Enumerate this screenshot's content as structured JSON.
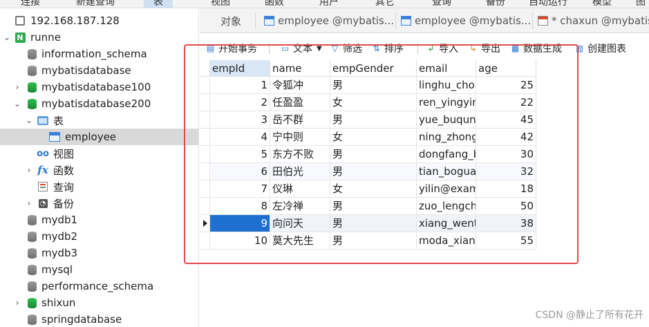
{
  "topbar": {
    "items": [
      "连接",
      "新建查询",
      "表",
      "视图",
      "函数",
      "用户",
      "其它",
      "查询",
      "备份",
      "自动运行",
      "模型",
      "图"
    ]
  },
  "sidebar": {
    "items": [
      {
        "label": "192.168.187.128",
        "icon": "server-icon"
      },
      {
        "label": "runne",
        "icon": "connection-icon"
      },
      {
        "label": "information_schema",
        "icon": "database-icon"
      },
      {
        "label": "mybatisdatabase",
        "icon": "database-icon"
      },
      {
        "label": "mybatisdatabase100",
        "icon": "database-open-icon"
      },
      {
        "label": "mybatisdatabase200",
        "icon": "database-open-icon"
      },
      {
        "label": "表",
        "icon": "tables-folder-icon"
      },
      {
        "label": "employee",
        "icon": "table-icon"
      },
      {
        "label": "视图",
        "icon": "views-icon"
      },
      {
        "label": "函数",
        "icon": "function-icon"
      },
      {
        "label": "查询",
        "icon": "query-icon"
      },
      {
        "label": "备份",
        "icon": "backup-icon"
      },
      {
        "label": "mydb1",
        "icon": "database-icon"
      },
      {
        "label": "mydb2",
        "icon": "database-icon"
      },
      {
        "label": "mydb3",
        "icon": "database-icon"
      },
      {
        "label": "mysql",
        "icon": "database-icon"
      },
      {
        "label": "performance_schema",
        "icon": "database-icon"
      },
      {
        "label": "shixun",
        "icon": "database-open-icon"
      },
      {
        "label": "springdatabase",
        "icon": "database-icon"
      }
    ]
  },
  "tabs": {
    "objects": "对象",
    "tab1": "employee @mybatis...",
    "tab2": "employee @mybatis...",
    "tab3": "* chaxun @mybatis"
  },
  "toolbar": {
    "begin_transaction": "开始事务",
    "text": "文本",
    "filter": "筛选",
    "sort": "排序",
    "import": "导入",
    "export": "导出",
    "data_generation": "数据生成",
    "create_chart": "创建图表"
  },
  "grid": {
    "columns": [
      "empId",
      "name",
      "empGender",
      "email",
      "age"
    ],
    "rows": [
      {
        "empId": "1",
        "name": "令狐冲",
        "empGender": "男",
        "email": "linghu_chon",
        "age": "25"
      },
      {
        "empId": "2",
        "name": "任盈盈",
        "empGender": "女",
        "email": "ren_yingyin",
        "age": "22"
      },
      {
        "empId": "3",
        "name": "岳不群",
        "empGender": "男",
        "email": "yue_buqun(",
        "age": "45"
      },
      {
        "empId": "4",
        "name": "宁中则",
        "empGender": "女",
        "email": "ning_zhong",
        "age": "42"
      },
      {
        "empId": "5",
        "name": "东方不败",
        "empGender": "男",
        "email": "dongfang_b",
        "age": "30"
      },
      {
        "empId": "6",
        "name": "田伯光",
        "empGender": "男",
        "email": "tian_boguar",
        "age": "32"
      },
      {
        "empId": "7",
        "name": "仪琳",
        "empGender": "女",
        "email": "yilin@exam",
        "age": "18"
      },
      {
        "empId": "8",
        "name": "左冷禅",
        "empGender": "男",
        "email": "zuo_lengcha",
        "age": "50"
      },
      {
        "empId": "9",
        "name": "向问天",
        "empGender": "男",
        "email": "xiang_wenti",
        "age": "38"
      },
      {
        "empId": "10",
        "name": "莫大先生",
        "empGender": "男",
        "email": "moda_xians",
        "age": "55"
      }
    ]
  },
  "watermark": "CSDN @静止了所有花开",
  "colors": {
    "selection": "#1f6fd1",
    "highlight_box": "#e5484d",
    "header_sorted": "#d8e6f5"
  }
}
